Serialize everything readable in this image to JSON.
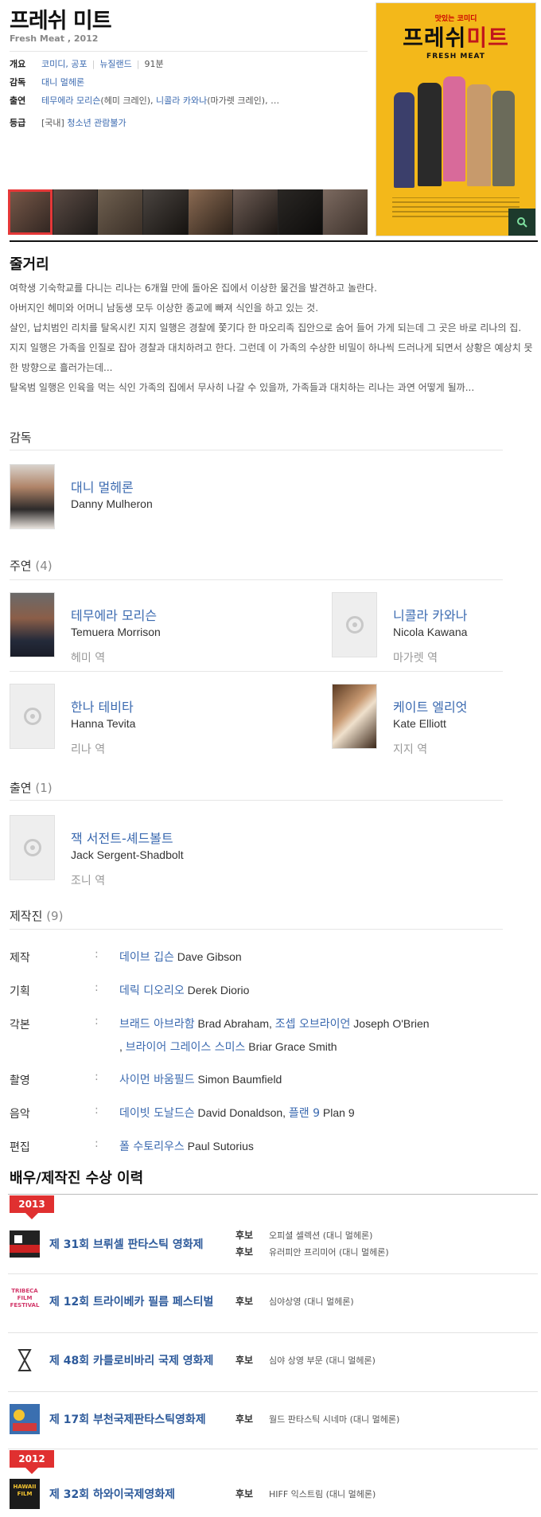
{
  "movie": {
    "title": "프레쉬 미트",
    "subtitle": "Fresh Meat , 2012"
  },
  "info": {
    "overview_label": "개요",
    "genre": "코미디, 공포",
    "country": "뉴질랜드",
    "runtime": "91분",
    "director_label": "감독",
    "director": "대니 멀헤론",
    "cast_label": "출연",
    "cast_1": "테무에라 모리슨",
    "cast_1_role": "(헤미 크레인)",
    "cast_2": "니콜라 카와나",
    "cast_2_role": "(마가렛 크레인)",
    "cast_more": "…",
    "rating_label": "등급",
    "rating_prefix": "[국내]",
    "rating": "청소년 관람불가"
  },
  "poster": {
    "tagline": "맛있는 코미디",
    "title_a": "프레쉬",
    "title_b": "미트",
    "title_en": "FRESH MEAT",
    "zoom_icon": "search-icon"
  },
  "plot": {
    "heading": "줄거리",
    "lines": [
      "여학생 기숙학교를 다니는 리나는 6개월 만에 돌아온 집에서 이상한 물건을 발견하고 놀란다.",
      " 아버지인 헤미와 어머니 남동생 모두 이상한 종교에 빠져 식인을 하고 있는 것.",
      " 살인, 납치범인 리치를 탈옥시킨 지지 일행은 경찰에 쫓기다 한 마오리족 집안으로 숨어 들어 가게 되는데 그 곳은 바로 리나의 집.",
      " 지지 일행은 가족을 인질로 잡아 경찰과 대치하려고 한다. 그런데 이 가족의 수상한 비밀이 하나씩 드러나게 되면서 상황은 예상치 못한 방향으로 흘러가는데...",
      " 탈옥범 일행은 인육을 먹는 식인 가족의 집에서 무사히 나갈 수 있을까, 가족들과 대치하는 리나는 과연 어떻게 될까..."
    ]
  },
  "director_section": {
    "heading": "감독",
    "name_ko": "대니 멀헤론",
    "name_en": "Danny Mulheron"
  },
  "lead_section": {
    "heading": "주연",
    "count": "(4)",
    "people": [
      {
        "name_ko": "테무에라 모리슨",
        "name_en": "Temuera Morrison",
        "role": "헤미 역"
      },
      {
        "name_ko": "니콜라 카와나",
        "name_en": "Nicola Kawana",
        "role": "마가렛 역"
      },
      {
        "name_ko": "한나 테비타",
        "name_en": "Hanna Tevita",
        "role": "리나 역"
      },
      {
        "name_ko": "케이트 엘리엇",
        "name_en": "Kate Elliott",
        "role": "지지 역"
      }
    ]
  },
  "support_section": {
    "heading": "출연",
    "count": "(1)",
    "people": [
      {
        "name_ko": "잭 서전트-셰드볼트",
        "name_en": "Jack Sergent-Shadbolt",
        "role": "조니 역"
      }
    ]
  },
  "staff_section": {
    "heading": "제작진",
    "count": "(9)",
    "colon": ":",
    "rows": [
      {
        "label": "제작",
        "ko1": "데이브 깁슨",
        "en1": " Dave Gibson"
      },
      {
        "label": "기획",
        "ko1": "데릭 디오리오",
        "en1": " Derek Diorio"
      },
      {
        "label": "각본",
        "ko1": "브래드 아브라함",
        "en1": " Brad Abraham, ",
        "ko2": "조셉 오브라이언",
        "en2": " Joseph O'Brien",
        "sep3": ", ",
        "ko3": "브라이어 그레이스 스미스",
        "en3": " Briar Grace Smith"
      },
      {
        "label": "촬영",
        "ko1": "사이먼 바움필드",
        "en1": " Simon Baumfield"
      },
      {
        "label": "음악",
        "ko1": "데이빗 도날드슨",
        "en1": " David Donaldson, ",
        "ko2": "플랜 9",
        "en2": " Plan 9"
      },
      {
        "label": "편집",
        "ko1": "폴 수토리우스",
        "en1": " Paul Sutorius"
      }
    ]
  },
  "awards": {
    "heading": "배우/제작진 수상 이력",
    "year_2013": "2013",
    "year_2012": "2012",
    "festivals": [
      {
        "name": "제 31회 브뤼셀 판타스틱 영화제",
        "results": [
          {
            "type": "후보",
            "award": "오피셜 셀렉션 (대니 멀헤론)"
          },
          {
            "type": "후보",
            "award": "유러피안 프리미어 (대니 멀헤론)"
          }
        ]
      },
      {
        "name": "제 12회 트라이베카 필름 페스티벌",
        "logo_text": "TRIBECA FILM FESTIVAL",
        "results": [
          {
            "type": "후보",
            "award": "심야상영 (대니 멀헤론)"
          }
        ]
      },
      {
        "name": "제 48회 카를로비바리 국제 영화제",
        "results": [
          {
            "type": "후보",
            "award": "심야 상영 부문 (대니 멀헤론)"
          }
        ]
      },
      {
        "name": "제 17회 부천국제판타스틱영화제",
        "results": [
          {
            "type": "후보",
            "award": "월드 판타스틱 시네마 (대니 멀헤론)"
          }
        ]
      },
      {
        "name": "제 32회 하와이국제영화제",
        "logo_text": "HAWAII FILM",
        "results": [
          {
            "type": "후보",
            "award": "HIFF 익스트림 (대니 멀헤론)"
          }
        ]
      }
    ]
  },
  "colors": {
    "link": "#3b6ab0",
    "ribbon": "#e03030",
    "poster": "#f3b81a",
    "festival_name": "#2d5a9b"
  }
}
